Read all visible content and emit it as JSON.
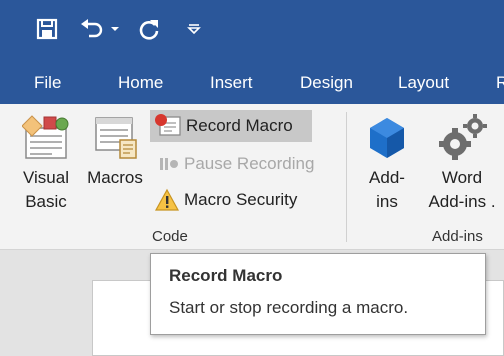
{
  "qat": {
    "icons": [
      "save-icon",
      "undo-icon",
      "undo-dropdown-icon",
      "redo-icon",
      "customize-qat-icon"
    ]
  },
  "tabs": [
    {
      "label": "File"
    },
    {
      "label": "Home"
    },
    {
      "label": "Insert"
    },
    {
      "label": "Design"
    },
    {
      "label": "Layout"
    },
    {
      "label": "R"
    }
  ],
  "ribbon": {
    "code_group": {
      "visual_basic_line1": "Visual",
      "visual_basic_line2": "Basic",
      "macros": "Macros",
      "record_macro": "Record Macro",
      "pause_recording": "Pause Recording",
      "macro_security": "Macro Security",
      "group_label": "Code"
    },
    "addins_group": {
      "addins_line1": "Add-",
      "addins_line2": "ins",
      "word_addins_line1": "Word",
      "word_addins_line2": "Add-ins",
      "word_addins_overflow": ".",
      "group_label": "Add-ins"
    }
  },
  "tooltip": {
    "title": "Record Macro",
    "body": "Start or stop recording a macro."
  },
  "colors": {
    "title_bar": "#2b579a",
    "ribbon_bg": "#f3f3f3",
    "hover_bg": "#c8c8c8",
    "disabled_text": "#a8a8a8",
    "addins_blue": "#1e6fc9",
    "gear_gray": "#6d6d6d"
  }
}
